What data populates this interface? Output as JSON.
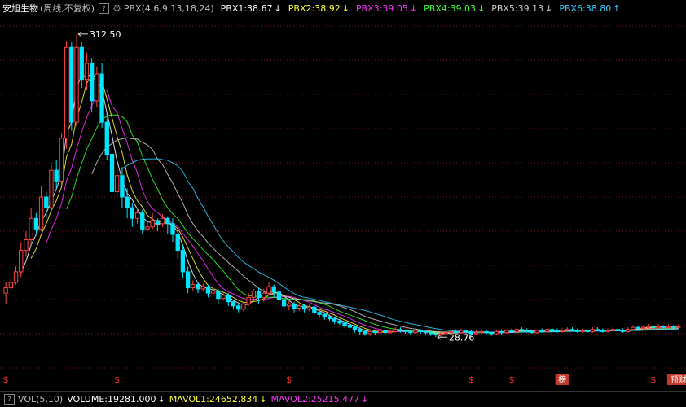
{
  "header": {
    "stock_name": "安旭生物",
    "period": "(周线,不复权)",
    "help_icon": "?",
    "indicator": "PBX(4,6,9,13,18,24)",
    "pbx": [
      {
        "label": "PBX1:38.67",
        "arrow": "↓",
        "color": "#ffffff"
      },
      {
        "label": "PBX2:38.92",
        "arrow": "↓",
        "color": "#ffff33"
      },
      {
        "label": "PBX3:39.05",
        "arrow": "↓",
        "color": "#ff33ff"
      },
      {
        "label": "PBX4:39.03",
        "arrow": "↓",
        "color": "#33ff33"
      },
      {
        "label": "PBX5:39.13",
        "arrow": "↓",
        "color": "#cccccc"
      },
      {
        "label": "PBX6:38.80",
        "arrow": "↑",
        "color": "#33ccff"
      }
    ]
  },
  "annotations": {
    "high_label": "312.50",
    "low_label": "28.76"
  },
  "markers": {
    "dollar": "$",
    "bang": "榜",
    "yucai": "预财"
  },
  "footer": {
    "help_icon": "?",
    "indicator": "VOL(5,10)",
    "items": [
      {
        "label": "VOLUME:19281.000",
        "arrow": "↓",
        "color": "#ffffff"
      },
      {
        "label": "MAVOL1:24652.834",
        "arrow": "↓",
        "color": "#ffff33"
      },
      {
        "label": "MAVOL2:25215.477",
        "arrow": "↓",
        "color": "#ff33ff"
      }
    ]
  },
  "colors": {
    "up": "#ff4444",
    "down": "#00e5ff",
    "grid": "#7a1515"
  },
  "chart_data": {
    "type": "candlestick",
    "title": "",
    "xlabel": "",
    "ylabel": "",
    "ylim": [
      0,
      320
    ],
    "high": 312.5,
    "low": 28.76,
    "candles": [
      [
        70,
        75,
        60,
        80
      ],
      [
        75,
        80,
        72,
        84
      ],
      [
        80,
        90,
        78,
        95
      ],
      [
        90,
        110,
        85,
        118
      ],
      [
        110,
        120,
        104,
        128
      ],
      [
        120,
        140,
        115,
        150
      ],
      [
        140,
        130,
        125,
        145
      ],
      [
        130,
        160,
        128,
        170
      ],
      [
        160,
        150,
        140,
        165
      ],
      [
        150,
        185,
        146,
        192
      ],
      [
        185,
        175,
        168,
        195
      ],
      [
        175,
        215,
        170,
        220
      ],
      [
        215,
        300,
        205,
        306
      ],
      [
        300,
        230,
        222,
        305
      ],
      [
        230,
        300,
        226,
        312.5
      ],
      [
        300,
        270,
        262,
        305
      ],
      [
        270,
        285,
        260,
        295
      ],
      [
        285,
        250,
        240,
        290
      ],
      [
        250,
        275,
        244,
        282
      ],
      [
        275,
        230,
        225,
        285
      ],
      [
        230,
        200,
        195,
        240
      ],
      [
        200,
        165,
        158,
        205
      ],
      [
        165,
        180,
        160,
        186
      ],
      [
        180,
        160,
        150,
        188
      ],
      [
        160,
        150,
        140,
        168
      ],
      [
        150,
        140,
        132,
        155
      ],
      [
        140,
        145,
        135,
        150
      ],
      [
        145,
        130,
        126,
        148
      ],
      [
        130,
        132,
        128,
        138
      ],
      [
        132,
        138,
        130,
        145
      ],
      [
        138,
        135,
        128,
        140
      ],
      [
        135,
        140,
        132,
        144
      ],
      [
        140,
        135,
        125,
        142
      ],
      [
        135,
        125,
        118,
        140
      ],
      [
        125,
        110,
        102,
        130
      ],
      [
        110,
        90,
        84,
        115
      ],
      [
        90,
        75,
        70,
        95
      ],
      [
        75,
        78,
        72,
        82
      ],
      [
        78,
        74,
        70,
        80
      ],
      [
        74,
        76,
        72,
        79
      ],
      [
        76,
        70,
        66,
        78
      ],
      [
        70,
        72,
        68,
        75
      ],
      [
        72,
        65,
        60,
        74
      ],
      [
        65,
        68,
        63,
        70
      ],
      [
        68,
        62,
        58,
        70
      ],
      [
        62,
        58,
        55,
        64
      ],
      [
        58,
        55,
        52,
        60
      ],
      [
        55,
        60,
        53,
        62
      ],
      [
        60,
        66,
        58,
        70
      ],
      [
        66,
        72,
        64,
        74
      ],
      [
        72,
        66,
        60,
        75
      ],
      [
        66,
        70,
        62,
        74
      ],
      [
        70,
        76,
        68,
        80
      ],
      [
        76,
        71,
        66,
        78
      ],
      [
        71,
        64,
        60,
        73
      ],
      [
        64,
        58,
        52,
        66
      ],
      [
        58,
        60,
        54,
        63
      ],
      [
        60,
        56,
        52,
        62
      ],
      [
        56,
        58,
        53,
        60
      ],
      [
        58,
        55,
        52,
        60
      ],
      [
        55,
        57,
        53,
        59
      ],
      [
        57,
        52,
        50,
        58
      ],
      [
        52,
        50,
        47,
        54
      ],
      [
        50,
        48,
        45,
        52
      ],
      [
        48,
        46,
        44,
        50
      ],
      [
        46,
        44,
        41,
        48
      ],
      [
        44,
        42,
        40,
        46
      ],
      [
        42,
        40,
        38,
        44
      ],
      [
        40,
        38,
        35,
        42
      ],
      [
        38,
        36,
        33,
        40
      ],
      [
        36,
        34,
        31,
        38
      ],
      [
        34,
        32,
        30,
        36
      ],
      [
        32,
        34,
        30,
        36
      ],
      [
        34,
        33,
        31,
        35
      ],
      [
        33,
        35,
        32,
        37
      ],
      [
        35,
        33,
        31,
        36
      ],
      [
        33,
        34,
        32,
        36
      ],
      [
        34,
        36,
        33,
        38
      ],
      [
        36,
        35,
        33,
        38
      ],
      [
        35,
        34,
        32,
        36
      ],
      [
        34,
        33,
        31,
        35
      ],
      [
        33,
        35,
        32,
        36
      ],
      [
        35,
        34,
        32,
        36
      ],
      [
        34,
        33,
        31,
        35
      ],
      [
        33,
        32,
        30,
        34
      ],
      [
        32,
        31,
        28.76,
        33
      ],
      [
        31,
        32,
        29,
        34
      ],
      [
        32,
        33,
        30,
        35
      ],
      [
        33,
        34,
        32,
        36
      ],
      [
        34,
        33,
        31,
        36
      ],
      [
        33,
        35,
        32,
        37
      ],
      [
        35,
        34,
        32,
        36
      ],
      [
        34,
        32,
        30,
        35
      ],
      [
        32,
        33,
        31,
        35
      ],
      [
        33,
        34,
        32,
        36
      ],
      [
        34,
        33,
        31,
        35
      ],
      [
        33,
        32,
        30,
        34
      ],
      [
        32,
        34,
        31,
        35
      ],
      [
        34,
        33,
        31,
        36
      ],
      [
        33,
        35,
        32,
        36
      ],
      [
        35,
        34,
        33,
        37
      ],
      [
        34,
        36,
        33,
        38
      ],
      [
        36,
        35,
        34,
        38
      ],
      [
        35,
        34,
        33,
        37
      ],
      [
        34,
        33,
        32,
        36
      ],
      [
        33,
        35,
        32,
        36
      ],
      [
        35,
        34,
        33,
        37
      ],
      [
        34,
        36,
        33,
        38
      ],
      [
        36,
        35,
        34,
        38
      ],
      [
        35,
        34,
        33,
        37
      ],
      [
        34,
        35,
        33,
        37
      ],
      [
        35,
        36,
        34,
        38
      ],
      [
        36,
        35,
        34,
        38
      ],
      [
        35,
        34,
        33,
        37
      ],
      [
        34,
        35,
        33,
        37
      ],
      [
        35,
        34,
        33,
        36
      ],
      [
        34,
        36,
        33,
        38
      ],
      [
        36,
        35,
        34,
        38
      ],
      [
        35,
        34,
        33,
        37
      ],
      [
        34,
        35,
        33,
        37
      ],
      [
        35,
        36,
        34,
        38
      ],
      [
        36,
        35,
        34,
        37
      ],
      [
        35,
        34,
        33,
        37
      ],
      [
        34,
        36,
        33,
        38
      ],
      [
        36,
        38,
        35,
        40
      ],
      [
        38,
        37,
        35,
        39
      ],
      [
        37,
        38,
        36,
        40
      ],
      [
        38,
        39,
        37,
        41
      ],
      [
        39,
        38,
        36,
        40
      ],
      [
        38,
        39,
        37,
        41
      ],
      [
        39,
        38,
        37,
        40
      ],
      [
        38,
        39,
        37,
        41
      ],
      [
        39,
        38,
        37,
        40
      ],
      [
        38,
        39,
        37,
        41
      ]
    ],
    "marker_positions": [
      {
        "index": 0,
        "type": "dollar"
      },
      {
        "index": 22,
        "type": "dollar"
      },
      {
        "index": 56,
        "type": "dollar"
      },
      {
        "index": 92,
        "type": "dollar"
      },
      {
        "index": 100,
        "type": "dollar"
      },
      {
        "index": 110,
        "type": "bang"
      },
      {
        "index": 128,
        "type": "dollar"
      },
      {
        "index": 148,
        "type": "yucai"
      }
    ]
  }
}
